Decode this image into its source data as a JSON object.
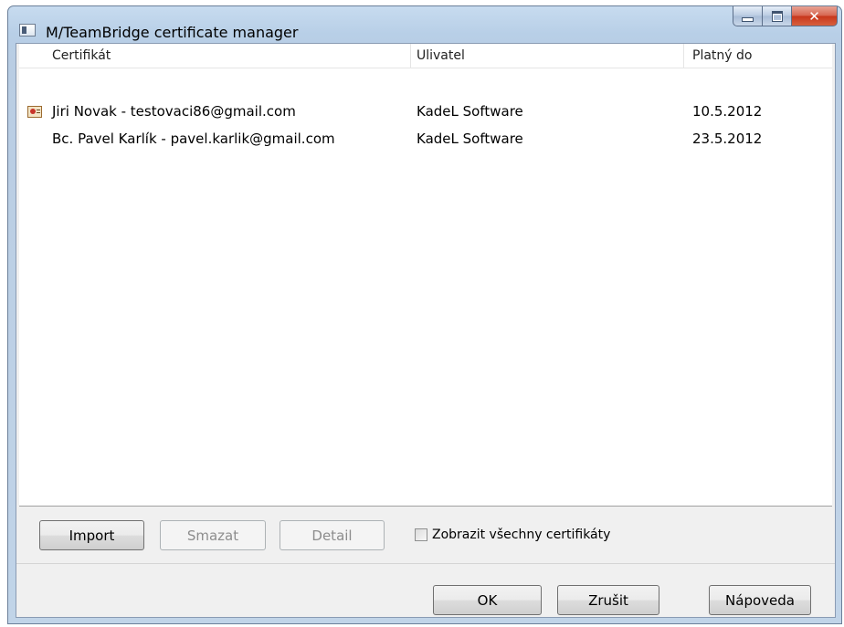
{
  "window": {
    "title": "M/TeamBridge certificate manager"
  },
  "listview": {
    "columns": [
      "Certifikát",
      "Ulivatel",
      "Platný do"
    ],
    "rows": [
      {
        "certificate": "Jiri Novak - testovaci86@gmail.com",
        "user": "KadeL Software",
        "valid_until": "10.5.2012",
        "icon": "certificate-icon"
      },
      {
        "certificate": "Bc. Pavel Karlík - pavel.karlik@gmail.com",
        "user": "KadeL Software",
        "valid_until": "23.5.2012",
        "icon": ""
      }
    ]
  },
  "toolbar": {
    "import_label": "Import",
    "delete_label": "Smazat",
    "detail_label": "Detail",
    "show_all_label": "Zobrazit všechny certifikáty",
    "show_all_checked": false
  },
  "footer": {
    "ok_label": "OK",
    "cancel_label": "Zrušit",
    "help_label": "Nápoveda"
  },
  "colors": {
    "title_gradient_top": "#c7dbef",
    "close_button": "#c7361b",
    "disabled_text": "#8d8d8d"
  }
}
